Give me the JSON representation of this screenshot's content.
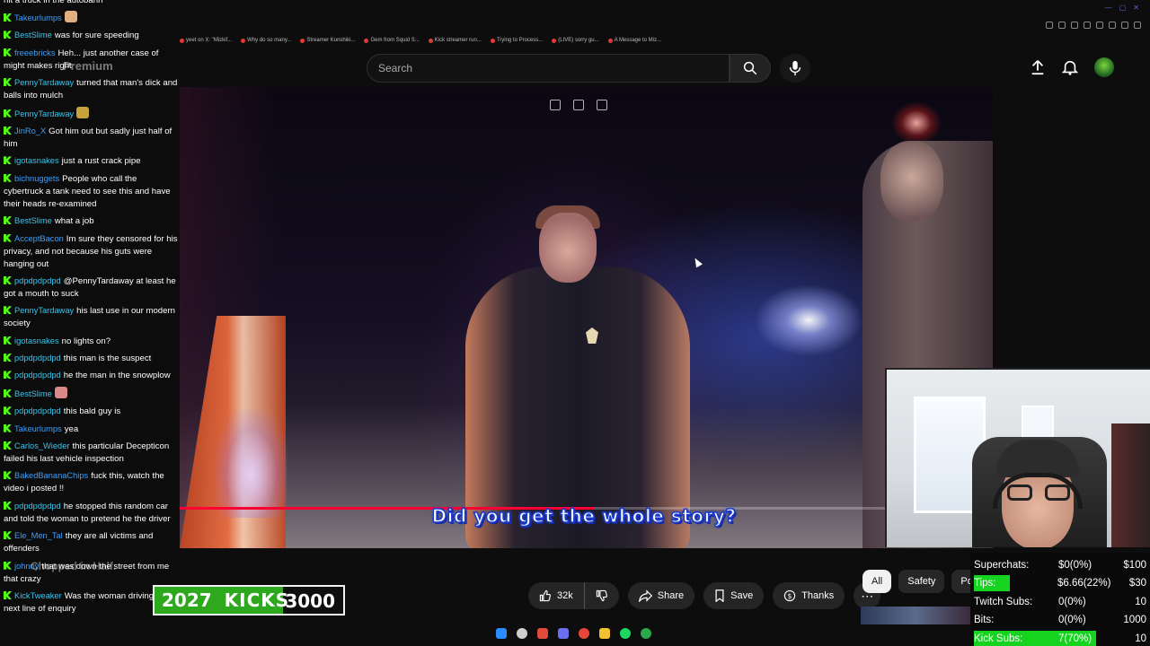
{
  "browser": {
    "bookmarks": [
      "yeet on X: \"Mizkif...",
      "Why do so many...",
      "Streamer Kunshiki...",
      "Gem from Squid S...",
      "Kick streamer run...",
      "Trying to Process...",
      "(LIVE) sorry gu...",
      "A Message to Miz..."
    ]
  },
  "youtube": {
    "search_placeholder": "Search",
    "caption": "Did you get the whole story?",
    "progress_fraction": 0.51,
    "likes": "32k",
    "share_label": "Share",
    "save_label": "Save",
    "thanks_label": "Thanks",
    "filter_chips": [
      "All",
      "Safety",
      "Polit"
    ],
    "overlay_watermark": "Chopped in Half."
  },
  "chat": {
    "top_fragment": "hit a truck in the autobahn",
    "watermark": "Premium",
    "messages": [
      {
        "user": "Takeurlumps",
        "color": "#3aa0ff",
        "text": "",
        "emote": "#e0b080"
      },
      {
        "user": "BestSlime",
        "color": "#35c6f0",
        "text": "was for sure speeding"
      },
      {
        "user": "freeebricks",
        "color": "#3aa0ff",
        "text": "Heh... just another case of might makes right"
      },
      {
        "user": "PennyTardaway",
        "color": "#35c6f0",
        "text": "turned that man's dick and balls into mulch"
      },
      {
        "user": "PennyTardaway",
        "color": "#35c6f0",
        "text": "",
        "emote": "#c6a23a"
      },
      {
        "user": "JinRo_X",
        "color": "#3aa0ff",
        "text": "Got him out but sadly just half of him"
      },
      {
        "user": "igotasnakes",
        "color": "#35c6f0",
        "text": "just a rust crack pipe"
      },
      {
        "user": "bichnuggets",
        "color": "#3aa0ff",
        "text": "People who call the cybertruck a tank need to see this and have their heads re-examined"
      },
      {
        "user": "BestSlime",
        "color": "#35c6f0",
        "text": "what a job"
      },
      {
        "user": "AcceptBacon",
        "color": "#3aa0ff",
        "text": "Im sure they censored for his privacy, and not because his guts were hanging out"
      },
      {
        "user": "pdpdpdpdpd",
        "color": "#35c6f0",
        "text": "@PennyTardaway at least he got a mouth to suck"
      },
      {
        "user": "PennyTardaway",
        "color": "#35c6f0",
        "text": "his last use in our modern society"
      },
      {
        "user": "igotasnakes",
        "color": "#35c6f0",
        "text": "no lights on?"
      },
      {
        "user": "pdpdpdpdpd",
        "color": "#35c6f0",
        "text": "this man is the suspect"
      },
      {
        "user": "pdpdpdpdpd",
        "color": "#35c6f0",
        "text": "he the man in the snowplow"
      },
      {
        "user": "BestSlime",
        "color": "#35c6f0",
        "text": "",
        "emote": "#d88a8a"
      },
      {
        "user": "pdpdpdpdpd",
        "color": "#35c6f0",
        "text": "this bald guy is"
      },
      {
        "user": "Takeurlumps",
        "color": "#3aa0ff",
        "text": "yea"
      },
      {
        "user": "Carlos_Wieder",
        "color": "#35c6f0",
        "text": "this particular Decepticon failed his last vehicle inspection"
      },
      {
        "user": "BakedBananaChips",
        "color": "#3aa0ff",
        "text": "fuck this, watch the video i posted !!"
      },
      {
        "user": "pdpdpdpdpd",
        "color": "#35c6f0",
        "text": "he stopped this random car and told the woman to pretend he the driver"
      },
      {
        "user": "Ele_Men_Tal",
        "color": "#3aa0ff",
        "text": "they are all victims and offenders"
      },
      {
        "user": "johnny",
        "color": "#3aa0ff",
        "text": "that was down the street from me that crazy"
      },
      {
        "user": "KickTweaker",
        "color": "#35c6f0",
        "text": "Was the woman driving is his next line of enquiry"
      }
    ]
  },
  "kicks": {
    "count": "2027",
    "label": "KICKS",
    "goal": "3000",
    "fraction": 0.68
  },
  "stats": {
    "rows": [
      {
        "label": "Superchats:",
        "value": "$0(0%)",
        "goal": "$100",
        "highlight": false
      },
      {
        "label": "Tips:",
        "value": "$6.66(22%)",
        "goal": "$30",
        "highlight": true
      },
      {
        "label": "Twitch Subs:",
        "value": "0(0%)",
        "goal": "10",
        "highlight": false
      },
      {
        "label": "Bits:",
        "value": "0(0%)",
        "goal": "1000",
        "highlight": false
      },
      {
        "label": "Kick Subs:",
        "value": "7(70%)",
        "goal": "10",
        "highlight": true
      }
    ]
  },
  "colors": {
    "kick_green": "#53fc18",
    "youtube_red": "#ff0033",
    "caption_stroke": "#1a3bcc"
  }
}
